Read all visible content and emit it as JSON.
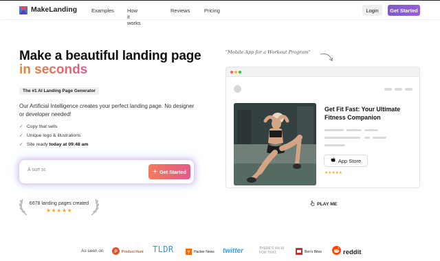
{
  "header": {
    "brand": "MakeLanding",
    "nav": [
      "Examples",
      "How it works",
      "Reviews",
      "Pricing"
    ],
    "login_label": "Login",
    "get_started_label": "Get Started"
  },
  "hero": {
    "title_line1": "Make a beautiful landing page",
    "title_line2": "in seconds",
    "badge": "The #1 AI Landing Page Generator",
    "description": "Our Artificial Intelligence creates your perfect landing page. No designer or developer needed!",
    "features": [
      {
        "text": "Copy that sells",
        "bold": ""
      },
      {
        "text": "Unique logo & illustrations",
        "bold": ""
      },
      {
        "text": "Site ready ",
        "bold": "today at 09:48 am"
      }
    ],
    "input_placeholder": "A surf sc",
    "cta_label": "Get Started",
    "count_text": "6678 landing pages created",
    "rating": 5
  },
  "preview": {
    "annotation": "\"Mobile App for a Workout Program\"",
    "mock_title": "Get Fit Fast: Your Ultimate Fitness Companion",
    "app_store_label": "App Store",
    "rating": 5,
    "play_label": "PLAY ME",
    "colors": {
      "dot_red": "#ff5f57",
      "dot_yellow": "#febc2e",
      "dot_green": "#28c840"
    }
  },
  "footer": {
    "as_seen_on": "As seen on",
    "brands": [
      "Product Hunt",
      "TLDR",
      "Hacker News",
      "twitter",
      "THERE'S AN AI FOR THAT",
      "Ben's Bites",
      "reddit"
    ]
  },
  "colors": {
    "accent_purple": "#8a5fd0",
    "accent_orange": "#f0832f",
    "accent_pink": "#e45a8a",
    "star": "#f5a623"
  }
}
